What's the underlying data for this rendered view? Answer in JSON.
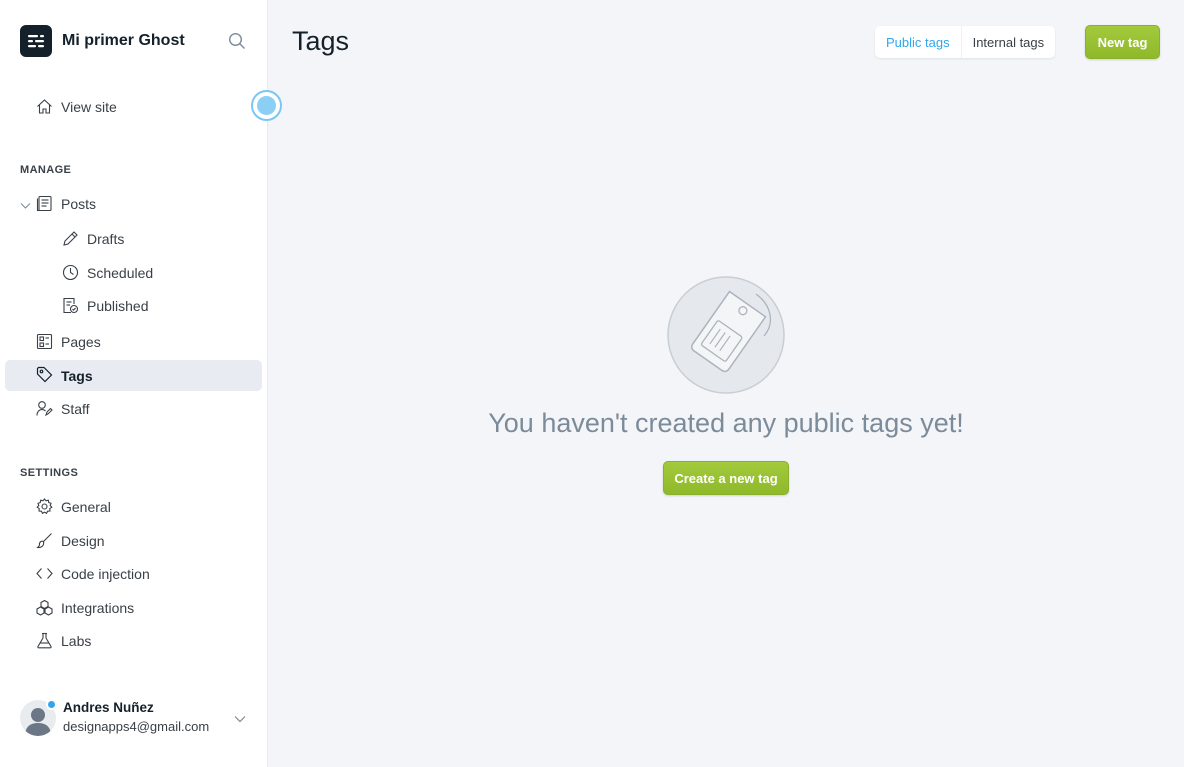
{
  "brand": {
    "name": "Mi primer Ghost"
  },
  "sidebar": {
    "view_site": "View site",
    "manage_title": "MANAGE",
    "posts": "Posts",
    "drafts": "Drafts",
    "scheduled": "Scheduled",
    "published": "Published",
    "pages": "Pages",
    "tags": "Tags",
    "staff": "Staff",
    "settings_title": "SETTINGS",
    "general": "General",
    "design": "Design",
    "code_injection": "Code injection",
    "integrations": "Integrations",
    "labs": "Labs"
  },
  "user": {
    "name": "Andres Nuñez",
    "email": "designapps4@gmail.com"
  },
  "main": {
    "title": "Tags",
    "tab_public": "Public tags",
    "tab_internal": "Internal tags",
    "new_tag": "New tag",
    "empty_message": "You haven't created any public tags yet!",
    "create_tag": "Create a new tag"
  },
  "colors": {
    "accent_green": "#9fc635",
    "accent_blue": "#30a6ee",
    "sidebar_active": "#e8ebf1"
  }
}
